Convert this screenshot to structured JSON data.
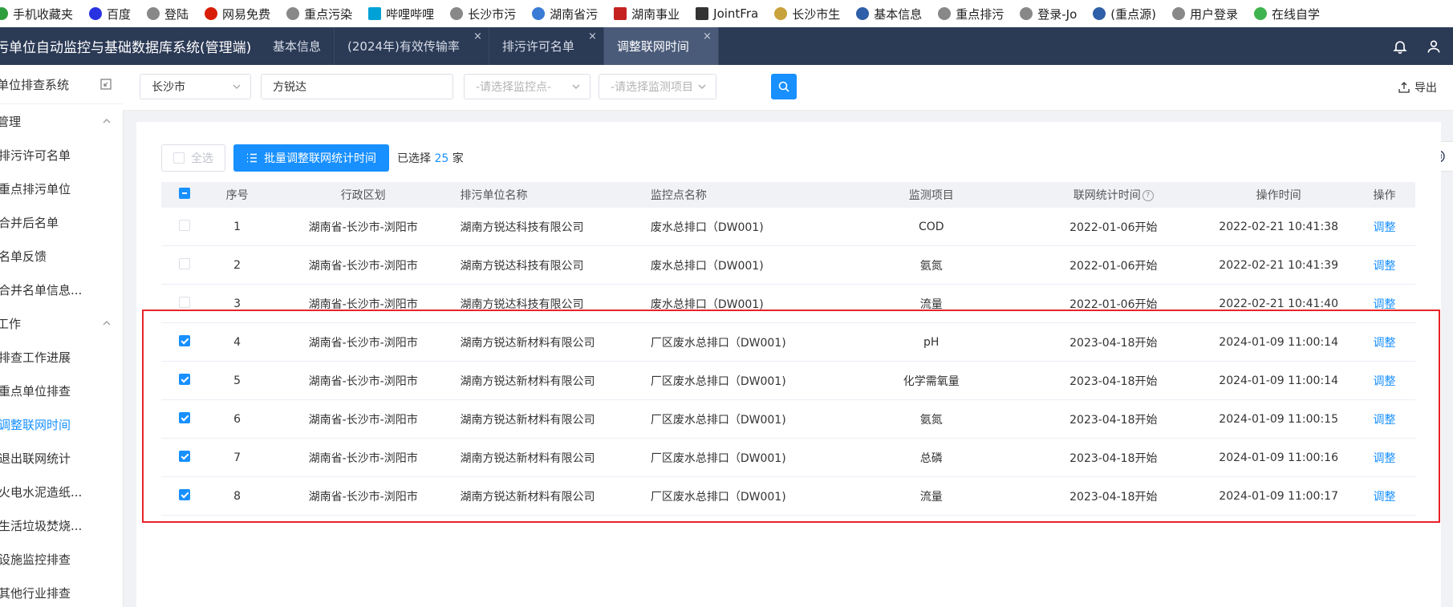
{
  "bookmarks": [
    {
      "label": "手机收藏夹",
      "icon": "phone-bookmark-icon",
      "color": "#2e9d3e"
    },
    {
      "label": "百度",
      "icon": "baidu-paw-icon",
      "color": "#2932e1"
    },
    {
      "label": "登陆",
      "icon": "globe-icon",
      "color": "#888888"
    },
    {
      "label": "网易免费",
      "icon": "netease-icon",
      "color": "#d81e06"
    },
    {
      "label": "重点污染",
      "icon": "globe-icon",
      "color": "#888888"
    },
    {
      "label": "哔哩哔哩",
      "icon": "bilibili-icon",
      "color": "#00a1d6"
    },
    {
      "label": "长沙市污",
      "icon": "globe-icon",
      "color": "#888888"
    },
    {
      "label": "湖南省污",
      "icon": "wave-logo-icon",
      "color": "#3a7bd5"
    },
    {
      "label": "湖南事业",
      "icon": "gmail-icon",
      "color": "#c5221f"
    },
    {
      "label": "JointFra",
      "icon": "jointfra-icon",
      "color": "#333333"
    },
    {
      "label": "长沙市生",
      "icon": "emblem-icon",
      "color": "#c8a23a"
    },
    {
      "label": "基本信息",
      "icon": "seal-icon",
      "color": "#2f5fa8"
    },
    {
      "label": "重点排污",
      "icon": "globe-icon",
      "color": "#888888"
    },
    {
      "label": "登录-Jo",
      "icon": "globe-icon",
      "color": "#888888"
    },
    {
      "label": "(重点源)",
      "icon": "seal-icon",
      "color": "#2f5fa8"
    },
    {
      "label": "用户登录",
      "icon": "globe-icon",
      "color": "#888888"
    },
    {
      "label": "在线自学",
      "icon": "leaf-icon",
      "color": "#3fb34f"
    }
  ],
  "header": {
    "title": "污单位自动监控与基础数据库系统(管理端)",
    "tabs": [
      {
        "label": "基本信息",
        "closable": false,
        "active": false
      },
      {
        "label": "(2024年)有效传输率",
        "closable": true,
        "active": false
      },
      {
        "label": "排污许可名单",
        "closable": true,
        "active": false
      },
      {
        "label": "调整联网时间",
        "closable": true,
        "active": true
      }
    ],
    "close_glyph": "×"
  },
  "sidebar": {
    "title": "单位排查系统",
    "groups": [
      {
        "label": "管理",
        "items": [
          "排污许可名单",
          "重点排污单位",
          "合并后名单",
          "名单反馈",
          "合并名单信息..."
        ]
      },
      {
        "label": "工作",
        "items": [
          "排查工作进展",
          "重点单位排查",
          "调整联网时间",
          "退出联网统计",
          "火电水泥造纸...",
          "生活垃圾焚烧...",
          "设施监控排查",
          "其他行业排查"
        ]
      }
    ],
    "active_item": "调整联网时间"
  },
  "filters": {
    "city": "长沙市",
    "company": "方锐达",
    "monitor_point_placeholder": "-请选择监控点-",
    "monitor_item_placeholder": "-请选择监测项目",
    "export_label": "导出"
  },
  "toolbar": {
    "select_all": "全选",
    "batch_button": "批量调整联网统计时间",
    "selected_prefix": "已选择",
    "selected_count": "25",
    "selected_suffix": "家"
  },
  "table": {
    "columns": [
      "序号",
      "行政区划",
      "排污单位名称",
      "监控点名称",
      "监测项目",
      "联网统计时间",
      "操作时间",
      "操作"
    ],
    "rows": [
      {
        "checked": false,
        "no": "1",
        "region": "湖南省-长沙市-浏阳市",
        "company": "湖南方锐达科技有限公司",
        "point": "废水总排口（DW001)",
        "item": "COD",
        "net_time": "2022-01-06开始",
        "op_time": "2022-02-21 10:41:38",
        "action": "调整"
      },
      {
        "checked": false,
        "no": "2",
        "region": "湖南省-长沙市-浏阳市",
        "company": "湖南方锐达科技有限公司",
        "point": "废水总排口（DW001)",
        "item": "氨氮",
        "net_time": "2022-01-06开始",
        "op_time": "2022-02-21 10:41:39",
        "action": "调整"
      },
      {
        "checked": false,
        "no": "3",
        "region": "湖南省-长沙市-浏阳市",
        "company": "湖南方锐达科技有限公司",
        "point": "废水总排口（DW001)",
        "item": "流量",
        "net_time": "2022-01-06开始",
        "op_time": "2022-02-21 10:41:40",
        "action": "调整"
      },
      {
        "checked": true,
        "no": "4",
        "region": "湖南省-长沙市-浏阳市",
        "company": "湖南方锐达新材料有限公司",
        "point": "厂区废水总排口（DW001)",
        "item": "pH",
        "net_time": "2023-04-18开始",
        "op_time": "2024-01-09 11:00:14",
        "action": "调整"
      },
      {
        "checked": true,
        "no": "5",
        "region": "湖南省-长沙市-浏阳市",
        "company": "湖南方锐达新材料有限公司",
        "point": "厂区废水总排口（DW001)",
        "item": "化学需氧量",
        "net_time": "2023-04-18开始",
        "op_time": "2024-01-09 11:00:14",
        "action": "调整"
      },
      {
        "checked": true,
        "no": "6",
        "region": "湖南省-长沙市-浏阳市",
        "company": "湖南方锐达新材料有限公司",
        "point": "厂区废水总排口（DW001)",
        "item": "氨氮",
        "net_time": "2023-04-18开始",
        "op_time": "2024-01-09 11:00:15",
        "action": "调整"
      },
      {
        "checked": true,
        "no": "7",
        "region": "湖南省-长沙市-浏阳市",
        "company": "湖南方锐达新材料有限公司",
        "point": "厂区废水总排口（DW001)",
        "item": "总磷",
        "net_time": "2023-04-18开始",
        "op_time": "2024-01-09 11:00:16",
        "action": "调整"
      },
      {
        "checked": true,
        "no": "8",
        "region": "湖南省-长沙市-浏阳市",
        "company": "湖南方锐达新材料有限公司",
        "point": "厂区废水总排口（DW001)",
        "item": "流量",
        "net_time": "2023-04-18开始",
        "op_time": "2024-01-09 11:00:17",
        "action": "调整"
      }
    ]
  },
  "colors": {
    "accent": "#1890ff",
    "header_bg": "#2b3a55",
    "highlight": "#e8242a"
  }
}
